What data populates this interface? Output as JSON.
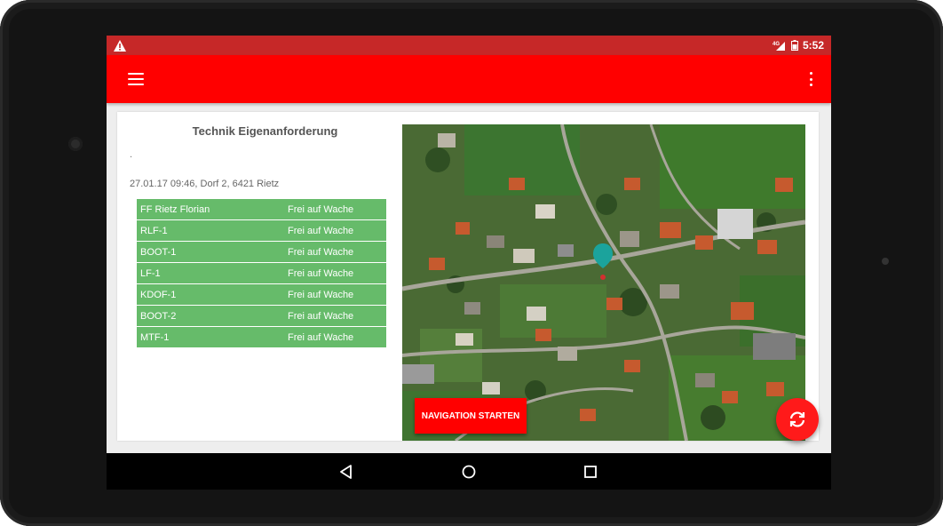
{
  "status_bar": {
    "time": "5:52",
    "network": "4G",
    "icons": [
      "warning-icon",
      "signal-icon",
      "battery-icon"
    ]
  },
  "app_bar": {
    "menu_icon": "menu-icon",
    "more_icon": "more-vert-icon"
  },
  "panel": {
    "title": "Technik Eigenanforderung",
    "dot": ".",
    "info": "27.01.17 09:46, Dorf 2, 6421 Rietz"
  },
  "units": [
    {
      "name": "FF Rietz Florian",
      "status": "Frei auf Wache"
    },
    {
      "name": "RLF-1",
      "status": "Frei auf Wache"
    },
    {
      "name": "BOOT-1",
      "status": "Frei auf Wache"
    },
    {
      "name": "LF-1",
      "status": "Frei auf Wache"
    },
    {
      "name": "KDOF-1",
      "status": "Frei auf Wache"
    },
    {
      "name": "BOOT-2",
      "status": "Frei auf Wache"
    },
    {
      "name": "MTF-1",
      "status": "Frei auf Wache"
    }
  ],
  "map": {
    "nav_button_label": "NAVIGATION STARTEN",
    "marker_icon": "map-marker-icon"
  },
  "fab": {
    "icon": "refresh-icon"
  },
  "nav_bar": {
    "icons": [
      "back-icon",
      "home-icon",
      "recents-icon"
    ]
  },
  "colors": {
    "status_bar": "#c62828",
    "app_bar": "#ff0000",
    "unit_row": "#66bb6a",
    "accent": "#ff0000",
    "marker": "#1ba39c"
  }
}
